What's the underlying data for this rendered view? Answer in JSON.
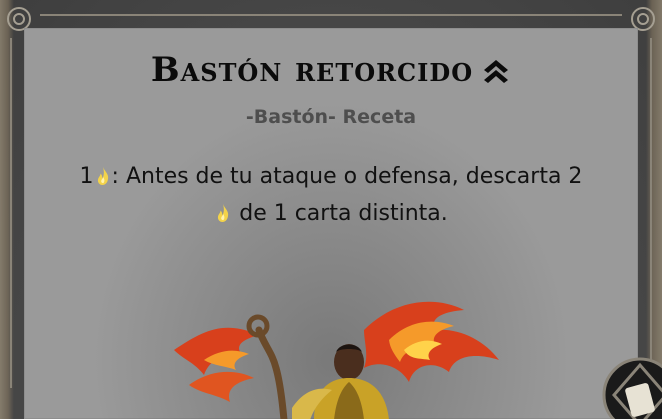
{
  "card": {
    "title": "Bastón retorcido",
    "upgrade_icon": "double-chevron-up-icon",
    "subtitle": "-Bastón- Receta",
    "ability": {
      "cost": "1",
      "line1_text": ": Antes de tu ataque o defensa, descarta 2",
      "line2_text": " de 1 carta distinta.",
      "resource_icon": "flame-icon"
    }
  },
  "colors": {
    "card_background": "#9a9a9a",
    "title": "#0b0b0b",
    "subtitle": "#4e4e4e",
    "flame": "#f3d34a"
  }
}
